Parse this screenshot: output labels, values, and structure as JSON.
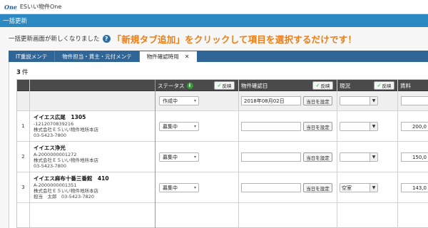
{
  "app": {
    "logo": "One",
    "title": "ESいい物件One"
  },
  "header": {
    "title": "一括更新"
  },
  "notice": {
    "text": "一括更新画面が新しくなりました",
    "help_glyph": "?",
    "highlight": "「新規タブ追加」をクリックして項目を選択するだけです！"
  },
  "tabs": [
    {
      "label": "IT重説メンテ"
    },
    {
      "label": "物件担当・賃主・元付メンテ"
    },
    {
      "label": "物件確認時用",
      "close": "✕"
    }
  ],
  "count": {
    "value": "3",
    "unit": "件"
  },
  "columns": {
    "status": "ステータス",
    "status_icon": "i",
    "confirm_date": "物件確認日",
    "current": "現況",
    "rent": "賃料",
    "reflect": "反映",
    "reflect_icon": "✓"
  },
  "filter": {
    "status": "作成中",
    "confirm_date": "2018年08月02日",
    "today_btn": "当日を設定",
    "current": "",
    "rent": ""
  },
  "rows": [
    {
      "num": "1",
      "name": "イイエス広尾　1305",
      "id": "-1212070839216",
      "company": "株式会社ＥＳいい物件地所本店",
      "tel": "03-5423-7800",
      "status": "募集中",
      "date": "",
      "today_btn": "当日を設定",
      "current": "",
      "rent": "200,0"
    },
    {
      "num": "2",
      "name": "イイエス浄光",
      "id": "A-2000000001272",
      "company": "株式会社ＥＳいい物件地所本店",
      "tel": "03-5423-7800",
      "status": "募集中",
      "date": "",
      "today_btn": "当日を設定",
      "current": "",
      "rent": "150,0"
    },
    {
      "num": "3",
      "name": "イイエス麻布十番三番館　410",
      "id": "A-2000000001351",
      "company": "株式会社ＥＳいい物件地所本店",
      "tel": "担当　太郎　03-5423-7820",
      "status": "募集中",
      "date": "",
      "today_btn": "当日を設定",
      "current": "空室",
      "rent": "143,0"
    }
  ],
  "icons": {
    "select_arrow": "▾",
    "combo_drop": "▼"
  }
}
